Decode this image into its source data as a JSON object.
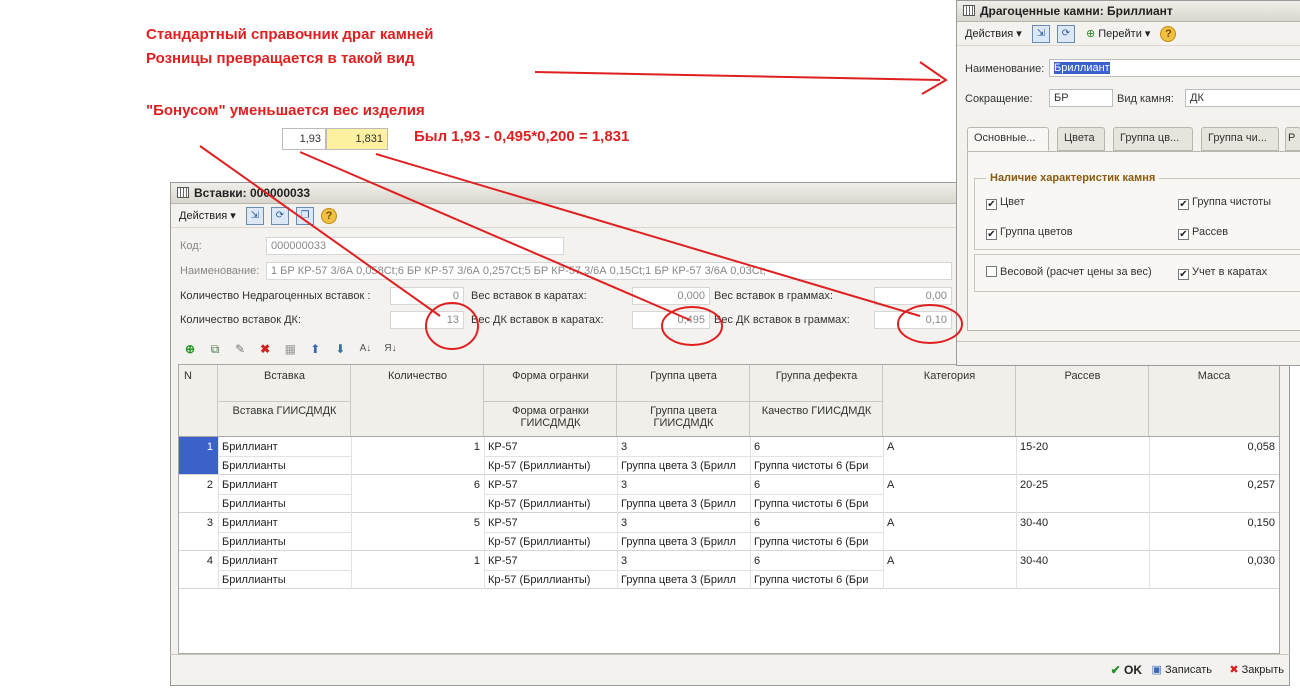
{
  "annotations": {
    "line1": "Стандартный справочник драг камней",
    "line2": "Розницы превращается  в такой вид",
    "bonus": "\"Бонусом\" уменьшается вес изделия",
    "formula": "Был 1,93 - 0,495*0,200 = 1,831",
    "old_weight": "1,93",
    "new_weight": "1,831"
  },
  "inserts_window": {
    "title": "Вставки: 000000033",
    "actions_label": "Действия",
    "code_label": "Код:",
    "code_value": "000000033",
    "name_label": "Наименование:",
    "name_value": "1 БР КР-57 3/6А 0,058Ct;6 БР КР-57 3/6А 0,257Ct;5 БР КР-57 3/6А 0,15Ct;1 БР КР-57 3/6А 0,03Ct;",
    "cheap_count_label": "Количество Недрагоценных вставок  :",
    "cheap_count_value": "0",
    "dk_count_label": "Количество вставок ДК:",
    "dk_count_value": "13",
    "carat_weight_label": "Вес вставок в каратах:",
    "carat_weight_value": "0,000",
    "dk_carat_label": "Вес ДК вставок в каратах:",
    "dk_carat_value": "0,495",
    "gram_weight_label": "Вес вставок в граммах:",
    "gram_weight_value": "0,00",
    "dk_gram_label": "Вес ДК вставок в граммах:",
    "dk_gram_value": "0,10",
    "grid": {
      "headers": {
        "n": "N",
        "insert": "Вставка",
        "insert_sub": "Вставка ГИИСДМДК",
        "qty": "Количество",
        "cut": "Форма огранки",
        "cut_sub": "Форма огранки ГИИСДМДК",
        "color": "Группа цвета",
        "color_sub": "Группа цвета ГИИСДМДК",
        "defect": "Группа дефекта",
        "defect_sub": "Качество ГИИСДМДК",
        "category": "Категория",
        "sieve": "Рассев",
        "mass": "Масса"
      },
      "rows": [
        {
          "n": "1",
          "insert": "Бриллиант",
          "insert_sub": "Бриллианты",
          "qty": "1",
          "cut": "КР-57",
          "cut_sub": "Кр-57 (Бриллианты)",
          "color": "3",
          "color_sub": "Группа цвета 3 (Брилл",
          "defect": "6",
          "defect_sub": "Группа чистоты 6 (Бри",
          "category": "А",
          "sieve": "15-20",
          "mass": "0,058"
        },
        {
          "n": "2",
          "insert": "Бриллиант",
          "insert_sub": "Бриллианты",
          "qty": "6",
          "cut": "КР-57",
          "cut_sub": "Кр-57 (Бриллианты)",
          "color": "3",
          "color_sub": "Группа цвета 3 (Брилл",
          "defect": "6",
          "defect_sub": "Группа чистоты 6 (Бри",
          "category": "А",
          "sieve": "20-25",
          "mass": "0,257"
        },
        {
          "n": "3",
          "insert": "Бриллиант",
          "insert_sub": "Бриллианты",
          "qty": "5",
          "cut": "КР-57",
          "cut_sub": "Кр-57 (Бриллианты)",
          "color": "3",
          "color_sub": "Группа цвета 3 (Брилл",
          "defect": "6",
          "defect_sub": "Группа чистоты 6 (Бри",
          "category": "А",
          "sieve": "30-40",
          "mass": "0,150"
        },
        {
          "n": "4",
          "insert": "Бриллиант",
          "insert_sub": "Бриллианты",
          "qty": "1",
          "cut": "КР-57",
          "cut_sub": "Кр-57 (Бриллианты)",
          "color": "3",
          "color_sub": "Группа цвета 3 (Брилл",
          "defect": "6",
          "defect_sub": "Группа чистоты 6 (Бри",
          "category": "А",
          "sieve": "30-40",
          "mass": "0,030"
        }
      ]
    },
    "footer": {
      "ok": "OK",
      "save": "Записать",
      "close": "Закрыть"
    }
  },
  "stone_window": {
    "title": "Драгоценные камни: Бриллиант",
    "actions_label": "Действия",
    "goto_label": "Перейти",
    "name_label": "Наименование:",
    "name_value": "Бриллиант",
    "short_label": "Сокращение:",
    "short_value": "БР",
    "type_label": "Вид камня:",
    "type_value": "ДК",
    "tabs": [
      "Основные...",
      "Цвета",
      "Группа цв...",
      "Группа чи...",
      "Р"
    ],
    "group_title": "Наличие характеристик камня",
    "checks": {
      "color": "Цвет",
      "clarity_group": "Группа чистоты",
      "color_group": "Группа цветов",
      "sieve": "Рассев",
      "weight_based": "Весовой (расчет цены за вес)",
      "carat_account": "Учет в каратах"
    },
    "checked": {
      "color": true,
      "clarity_group": true,
      "color_group": true,
      "sieve": true,
      "weight_based": false,
      "carat_account": true
    }
  },
  "colors": {
    "annotation_red": "#e02020",
    "highlight_yellow": "#fdf0a0",
    "row_select_blue": "#3a62c8"
  }
}
